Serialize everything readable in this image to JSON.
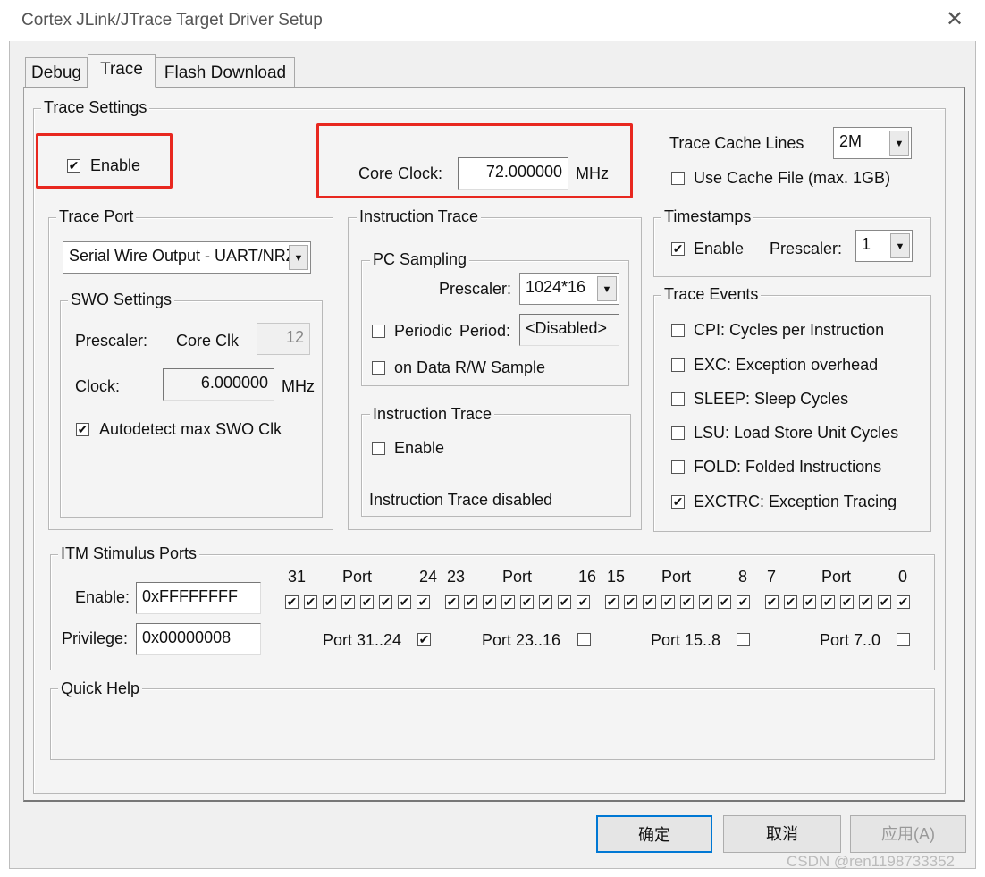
{
  "window": {
    "title": "Cortex JLink/JTrace Target Driver Setup",
    "close_glyph": "✕"
  },
  "tabs": [
    {
      "label": "Debug",
      "active": false
    },
    {
      "label": "Trace",
      "active": true
    },
    {
      "label": "Flash Download",
      "active": false
    }
  ],
  "trace_settings": {
    "group_label": "Trace Settings",
    "enable_label": "Enable",
    "enable_checked": true,
    "core_clock_label": "Core Clock:",
    "core_clock_value": "72.000000",
    "core_clock_unit": "MHz",
    "cache_lines_label": "Trace Cache Lines",
    "cache_lines_value": "2M",
    "use_cache_file_label": "Use Cache File (max. 1GB)",
    "use_cache_file_checked": false
  },
  "trace_port": {
    "group_label": "Trace Port",
    "port_value": "Serial Wire Output - UART/NRZ",
    "swo_settings": {
      "group_label": "SWO Settings",
      "prescaler_label": "Prescaler:",
      "core_clk_label": "Core Clk",
      "prescaler_value": "12",
      "clock_label": "Clock:",
      "clock_value": "6.000000",
      "clock_unit": "MHz",
      "autodetect_label": "Autodetect max SWO Clk",
      "autodetect_checked": true
    }
  },
  "instruction_trace_outer": {
    "group_label": "Instruction Trace",
    "pc_sampling": {
      "group_label": "PC Sampling",
      "prescaler_label": "Prescaler:",
      "prescaler_value": "1024*16",
      "periodic_label": "Periodic",
      "period_label": "Period:",
      "period_value": "<Disabled>",
      "periodic_checked": false,
      "on_data_label": "on Data R/W Sample",
      "on_data_checked": false
    },
    "instruction_trace": {
      "group_label": "Instruction Trace",
      "enable_label": "Enable",
      "enable_checked": false,
      "status": "Instruction Trace disabled"
    }
  },
  "timestamps": {
    "group_label": "Timestamps",
    "enable_label": "Enable",
    "enable_checked": true,
    "prescaler_label": "Prescaler:",
    "prescaler_value": "1"
  },
  "trace_events": {
    "group_label": "Trace Events",
    "items": [
      {
        "label": "CPI: Cycles per Instruction",
        "checked": false
      },
      {
        "label": "EXC: Exception overhead",
        "checked": false
      },
      {
        "label": "SLEEP: Sleep Cycles",
        "checked": false
      },
      {
        "label": "LSU: Load Store Unit Cycles",
        "checked": false
      },
      {
        "label": "FOLD: Folded Instructions",
        "checked": false
      },
      {
        "label": "EXCTRC: Exception Tracing",
        "checked": true
      }
    ]
  },
  "itm": {
    "group_label": "ITM Stimulus Ports",
    "enable_label": "Enable:",
    "enable_value": "0xFFFFFFFF",
    "privilege_label": "Privilege:",
    "privilege_value": "0x00000008",
    "port_word": "Port",
    "groups": [
      {
        "hi": "31",
        "lo": "24",
        "priv_label": "Port 31..24",
        "priv_checked": true
      },
      {
        "hi": "23",
        "lo": "16",
        "priv_label": "Port 23..16",
        "priv_checked": false
      },
      {
        "hi": "15",
        "lo": "8",
        "priv_label": "Port 15..8",
        "priv_checked": false
      },
      {
        "hi": "7",
        "lo": "0",
        "priv_label": "Port 7..0",
        "priv_checked": false
      }
    ]
  },
  "quick_help": {
    "group_label": "Quick Help"
  },
  "buttons": {
    "ok": "确定",
    "cancel": "取消",
    "apply": "应用(A)"
  },
  "watermark": "CSDN @ren1198733352",
  "colors": {
    "highlight": "#e8271f",
    "dialog_bg": "#f0f0f0"
  }
}
